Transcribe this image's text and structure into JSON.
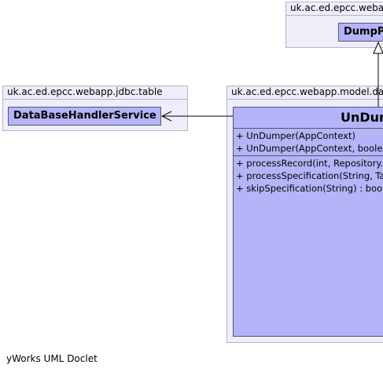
{
  "packages": {
    "top_right": "uk.ac.ed.epcc.webapp.model.data.Dump",
    "left": "uk.ac.ed.epcc.webapp.jdbc.table",
    "right": "uk.ac.ed.epcc.webapp.model.data.Dump"
  },
  "classes": {
    "dump_parent": "DumpParser",
    "db_handler": "DataBaseHandlerService",
    "undumper": "UnDumper"
  },
  "undumper_constructors": [
    "+  UnDumper(AppContext)",
    "+  UnDumper(AppContext, boolean)"
  ],
  "undumper_methods": [
    "+  processRecord(int, Repository.Record)",
    "+  processSpecification(String, TableSpecification)",
    "+  skipSpecification(String) : boolean"
  ],
  "footer": "yWorks UML Doclet"
}
